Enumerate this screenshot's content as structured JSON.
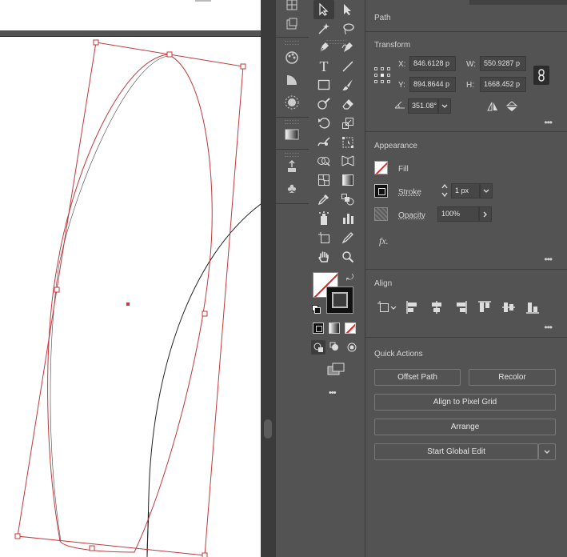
{
  "panel": {
    "tab_title": "Path",
    "transform": {
      "title": "Transform",
      "x_label": "X:",
      "x_value": "846.6128 p",
      "y_label": "Y:",
      "y_value": "894.8644 p",
      "w_label": "W:",
      "w_value": "550.9287 p",
      "h_label": "H:",
      "h_value": "1668.452 p",
      "angle_value": "351.08°"
    },
    "appearance": {
      "title": "Appearance",
      "fill_label": "Fill",
      "stroke_label": "Stroke",
      "stroke_weight": "1 px",
      "opacity_label": "Opacity",
      "opacity_value": "100%",
      "fx_label": "fx."
    },
    "align": {
      "title": "Align"
    },
    "quick_actions": {
      "title": "Quick Actions",
      "offset_path": "Offset Path",
      "recolor": "Recolor",
      "align_pixel": "Align to Pixel Grid",
      "arrange": "Arrange",
      "global_edit": "Start Global Edit"
    },
    "more_label": "•••"
  },
  "tools": {
    "more_label": "•••"
  },
  "colors": {
    "selection": "#c0393b",
    "panel_bg": "#535353",
    "dark_bg": "#3b3b3b"
  }
}
